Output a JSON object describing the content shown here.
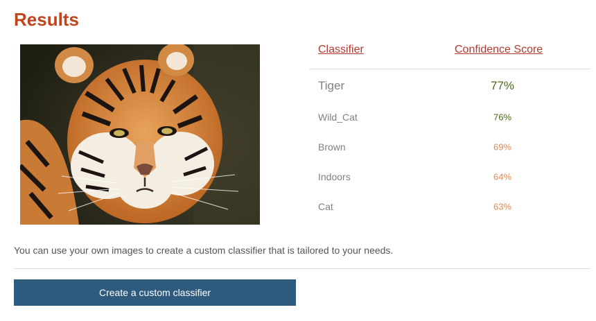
{
  "page": {
    "title": "Results",
    "image_alt": "tiger photo",
    "note": "You can use your own images to create a custom classifier that is tailored to your needs.",
    "cta_label": "Create a custom classifier"
  },
  "table": {
    "headers": [
      "Classifier",
      "Confidence Score"
    ],
    "rows": [
      {
        "label": "Tiger",
        "score": "77%",
        "score_color": "#4a6a1a"
      },
      {
        "label": "Wild_Cat",
        "score": "76%",
        "score_color": "#4a6a1a"
      },
      {
        "label": "Brown",
        "score": "69%",
        "score_color": "#e08a52"
      },
      {
        "label": "Indoors",
        "score": "64%",
        "score_color": "#e08a52"
      },
      {
        "label": "Cat",
        "score": "63%",
        "score_color": "#e08a52"
      }
    ]
  },
  "colors": {
    "title": "#c0441c",
    "header_link": "#b03a2e",
    "button_bg": "#2e5a7e"
  }
}
